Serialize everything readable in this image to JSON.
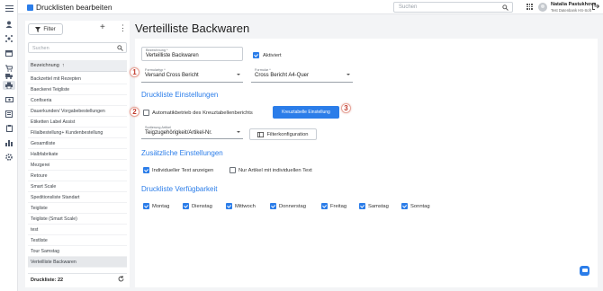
{
  "app": {
    "title": "Drucklisten bearbeiten",
    "search_placeholder": "Suchen",
    "user_name": "Natalia Pastukhova",
    "user_org": "Test Datenbank HS-Soft"
  },
  "rail": {
    "icons": [
      "menu-icon",
      "user-icon",
      "network-icon",
      "shop-icon",
      "cart-icon",
      "truck-icon",
      "printer-icon",
      "money-icon",
      "invoice-icon",
      "clipboard-icon",
      "chart-icon",
      "settings-icon"
    ],
    "active_index": 6
  },
  "list": {
    "filter_label": "Filter",
    "search_placeholder": "Suchen",
    "header_label": "Bezeichnung",
    "items": [
      "Backzettel mit Rezepten",
      "Baeckerei Teigliste",
      "Confiseria",
      "Dauerkunden/ Vorgabebestellungen",
      "Etiketten Label Assist",
      "Filialbestellung+ Kundenbestellung",
      "Gesamtliste",
      "Halbfabrikate",
      "Mezgerei",
      "Retoure",
      "Smart Scale",
      "Speditionsliste Standart",
      "Teigliste",
      "Teigliste (Smart Scale)",
      "test",
      "Testliste",
      "Tour Samstag",
      "Verteilliste Backwaren"
    ],
    "selected_index": 17,
    "footer_label": "Druckliste: 22"
  },
  "main": {
    "title": "Verteilliste Backwaren",
    "name_field": {
      "label": "Bezeichnung *",
      "value": "Verteilliste Backwaren"
    },
    "active_label": "Aktiviert",
    "active_checked": true,
    "formular_typ": {
      "label": "Formulartyp *",
      "value": "Versand Cross Bericht"
    },
    "formular": {
      "label": "Formular *",
      "value": "Cross Bericht A4-Quer"
    },
    "section_druckliste": "Druckliste Einstellungen",
    "auto_label": "Automatikbetrieb des Kreuztabellenberichts",
    "auto_checked": false,
    "kreuztabelle_button": "Kreuztabelle Einstellung",
    "sortierung": {
      "label": "Sortierung Artikel",
      "value": "Teigzugehörigkeit/Artikel-Nr."
    },
    "filter_button": "Filterkonfiguration",
    "section_zusatz": "Zusätzliche Einstellungen",
    "individueller_label": "Individueller Text anzeigen",
    "individueller_checked": true,
    "nur_artikel_label": "Nur Artikel mit individuellen Text",
    "nur_artikel_checked": false,
    "section_verfuegbarkeit": "Druckliste Verfügbarkeit",
    "days": [
      {
        "label": "Montag",
        "checked": true
      },
      {
        "label": "Dienstag",
        "checked": true
      },
      {
        "label": "Mittwoch",
        "checked": true
      },
      {
        "label": "Donnerstag",
        "checked": true
      },
      {
        "label": "Freitag",
        "checked": true
      },
      {
        "label": "Samstag",
        "checked": true
      },
      {
        "label": "Sonntag",
        "checked": true
      }
    ],
    "badges": [
      "1",
      "2",
      "3"
    ]
  },
  "colors": {
    "accent": "#2b7de9",
    "badge": "#c0392b"
  }
}
